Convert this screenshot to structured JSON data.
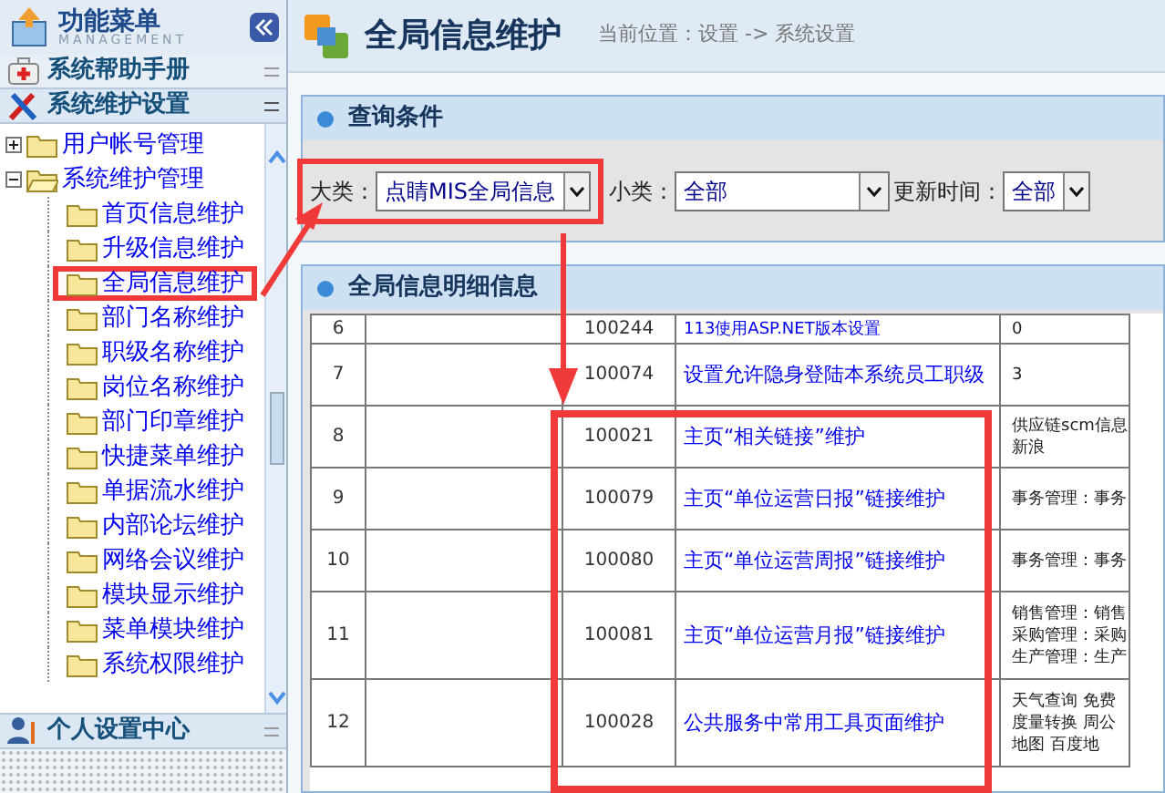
{
  "sidebar": {
    "title": "功能菜单",
    "subtitle": "MANAGEMENT",
    "sections": [
      {
        "label": "系统帮助手册",
        "kind": "help",
        "expanded": false
      },
      {
        "label": "系统维护设置",
        "kind": "tools",
        "expanded": true
      }
    ],
    "tree": [
      {
        "label": "用户帐号管理",
        "expanded": false
      },
      {
        "label": "系统维护管理",
        "expanded": true,
        "children": [
          {
            "label": "首页信息维护",
            "selected": false
          },
          {
            "label": "升级信息维护",
            "selected": false
          },
          {
            "label": "全局信息维护",
            "selected": true
          },
          {
            "label": "部门名称维护",
            "selected": false
          },
          {
            "label": "职级名称维护",
            "selected": false
          },
          {
            "label": "岗位名称维护",
            "selected": false
          },
          {
            "label": "部门印章维护",
            "selected": false
          },
          {
            "label": "快捷菜单维护",
            "selected": false
          },
          {
            "label": "单据流水维护",
            "selected": false
          },
          {
            "label": "内部论坛维护",
            "selected": false
          },
          {
            "label": "网络会议维护",
            "selected": false
          },
          {
            "label": "模块显示维护",
            "selected": false
          },
          {
            "label": "菜单模块维护",
            "selected": false
          },
          {
            "label": "系统权限维护",
            "selected": false
          }
        ]
      }
    ],
    "footer_section": {
      "label": "个人设置中心"
    }
  },
  "header": {
    "title": "全局信息维护",
    "breadcrumb": "当前位置：设置 -> 系统设置"
  },
  "query_panel": {
    "title": "查询条件",
    "filters": [
      {
        "label": "大类：",
        "value": "点睛MIS全局信息"
      },
      {
        "label": "小类：",
        "value": "全部"
      },
      {
        "label": "更新时间：",
        "value": "全部"
      }
    ]
  },
  "detail_panel": {
    "title": "全局信息明细信息",
    "rows": [
      {
        "index": "6",
        "id": "100244",
        "name": "113使用ASP.NET版本设置",
        "value": [
          "0"
        ]
      },
      {
        "index": "7",
        "id": "100074",
        "name": "设置允许隐身登陆本系统员工职级",
        "value": [
          "3"
        ]
      },
      {
        "index": "8",
        "id": "100021",
        "name": "主页“相关链接”维护",
        "value": [
          "供应链scm信息",
          "新浪"
        ]
      },
      {
        "index": "9",
        "id": "100079",
        "name": "主页“单位运营日报”链接维护",
        "value": [
          "事务管理：事务"
        ]
      },
      {
        "index": "10",
        "id": "100080",
        "name": "主页“单位运营周报”链接维护",
        "value": [
          "事务管理：事务"
        ]
      },
      {
        "index": "11",
        "id": "100081",
        "name": "主页“单位运营月报”链接维护",
        "value": [
          "销售管理：销售",
          "采购管理：采购",
          "生产管理：生产"
        ]
      },
      {
        "index": "12",
        "id": "100028",
        "name": "公共服务中常用工具页面维护",
        "value": [
          "天气查询 免费",
          "度量转换 周公",
          "地图 百度地"
        ]
      }
    ]
  }
}
